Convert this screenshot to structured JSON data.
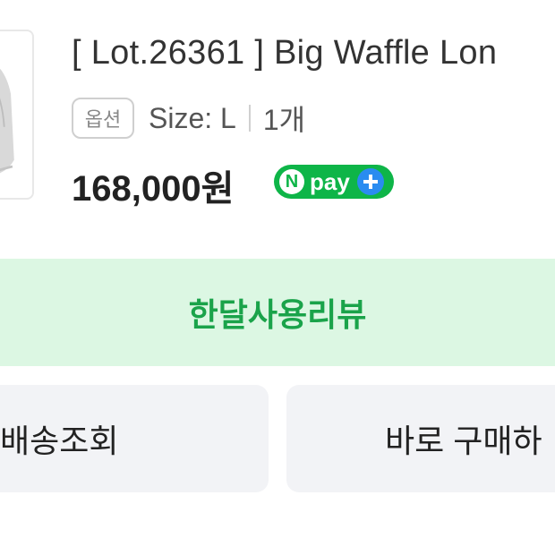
{
  "product": {
    "title": "[ Lot.26361 ] Big Waffle Lon",
    "option_chip": "옵션",
    "size": "Size: L",
    "quantity": "1개",
    "price": "168,000원"
  },
  "npay": {
    "badge_letter": "N",
    "label": "pay",
    "color": "#0eb548",
    "plus_color": "#2a8cf0"
  },
  "review_banner": {
    "label": "한달사용리뷰",
    "color": "#1aa34a",
    "background": "#dcf7e3"
  },
  "actions": {
    "delivery_label": "배송조회",
    "buy_label": "바로 구매하"
  },
  "icons": {
    "thumbnail": "product-thumbnail-image",
    "npay": "npay-logo",
    "plus": "plus-icon"
  }
}
